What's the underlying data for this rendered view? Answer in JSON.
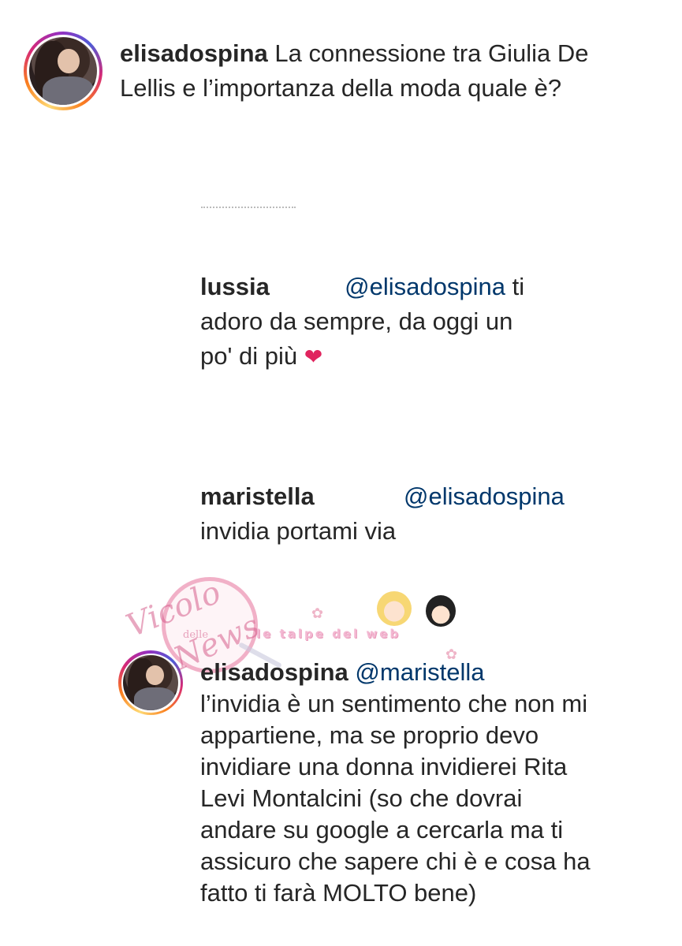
{
  "comments": [
    {
      "username": "elisadospina",
      "text": "La connessione tra Giulia De Lellis e l’importanza della moda quale è?"
    },
    {
      "username": "lussia",
      "mention": "@elisadospina",
      "text": "ti adoro da sempre, da oggi un po' di più",
      "emoji": "❤"
    },
    {
      "username": "maristella",
      "mention": "@elisadospina",
      "text": "invidia portami via"
    },
    {
      "username": "elisadospina",
      "mention": "@maristella",
      "text": "l’invidia è un sentimento che non mi appartiene, ma se proprio devo invidiare una donna invidierei Rita Levi Montalcini (so che dovrai andare su google a cercarla ma ti assicuro che sapere chi è e cosa ha fatto ti farà MOLTO bene)"
    }
  ],
  "watermark": {
    "line1": "Vicolo",
    "line2": "delle",
    "line3": "News",
    "band": "le talpe del web"
  },
  "colors": {
    "mention": "#00376b",
    "text": "#262626"
  }
}
